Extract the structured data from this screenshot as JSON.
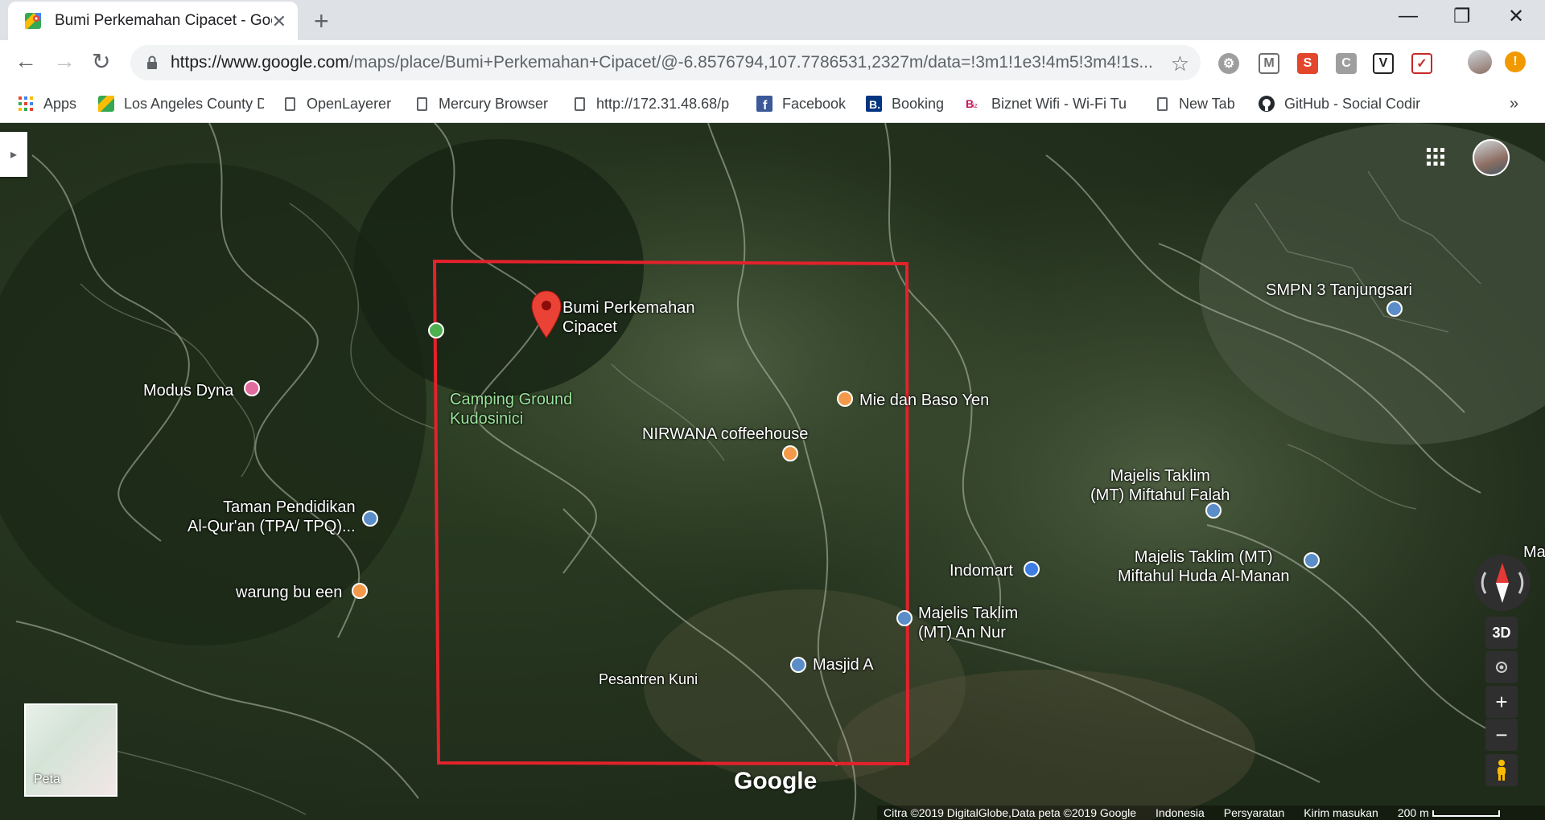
{
  "browser": {
    "tab_title": "Bumi Perkemahan Cipacet - Google Maps",
    "url_host": "https://www.google.com",
    "url_path": "/maps/place/Bumi+Perkemahan+Cipacet/@-6.8576794,107.7786531,2327m/data=!3m1!1e3!4m5!3m4!1s...",
    "bookmarks": [
      {
        "label": "Apps"
      },
      {
        "label": "Los Angeles County D"
      },
      {
        "label": "OpenLayerer"
      },
      {
        "label": "Mercury Browser"
      },
      {
        "label": "http://172.31.48.68/p"
      },
      {
        "label": "Facebook"
      },
      {
        "label": "Booking"
      },
      {
        "label": "Biznet Wifi - Wi-Fi Tu"
      },
      {
        "label": "New Tab"
      },
      {
        "label": "GitHub - Social Codir"
      }
    ],
    "overflow": "»"
  },
  "map": {
    "places": {
      "bumi": "Bumi Perkemahan\nCipacet",
      "camping": "Camping Ground\nKudosinici",
      "modus": "Modus Dyna",
      "mie": "Mie dan Baso Yen",
      "nirwana": "NIRWANA coffeehouse",
      "smpn": "SMPN 3 Tanjungsari",
      "majelis_falah": "Majelis Taklim\n(MT) Miftahul Falah",
      "taman": "Taman Pendidikan\nAl-Qur'an (TPA/ TPQ)...",
      "indomart": "Indomart",
      "majelis_huda": "Majelis Taklim (MT)\nMiftahul Huda Al-Manan",
      "ma": "Ma",
      "warung": "warung bu een",
      "majelis_annur": "Majelis Taklim\n(MT) An Nur",
      "masjid": "Masjid A",
      "bottom_cut": "Pesantren Kuni"
    },
    "controls": {
      "three_d": "3D",
      "zoom_in": "+",
      "zoom_out": "−",
      "thumbnail_label": "Peta"
    },
    "logo": "Google",
    "footer": {
      "attribution": "Citra ©2019 DigitalGlobe,Data peta ©2019 Google",
      "country": "Indonesia",
      "terms": "Persyaratan",
      "feedback": "Kirim masukan",
      "scale": "200 m"
    }
  },
  "colors": {
    "highlight_box": "#e3222b",
    "marker": "#ea4335",
    "food_pin": "#f29a4a",
    "edu_pin": "#5b8dc8",
    "shop_pin": "#3d7de4",
    "hotel_pin": "#e36a9c",
    "park_pin": "#4caf50"
  }
}
